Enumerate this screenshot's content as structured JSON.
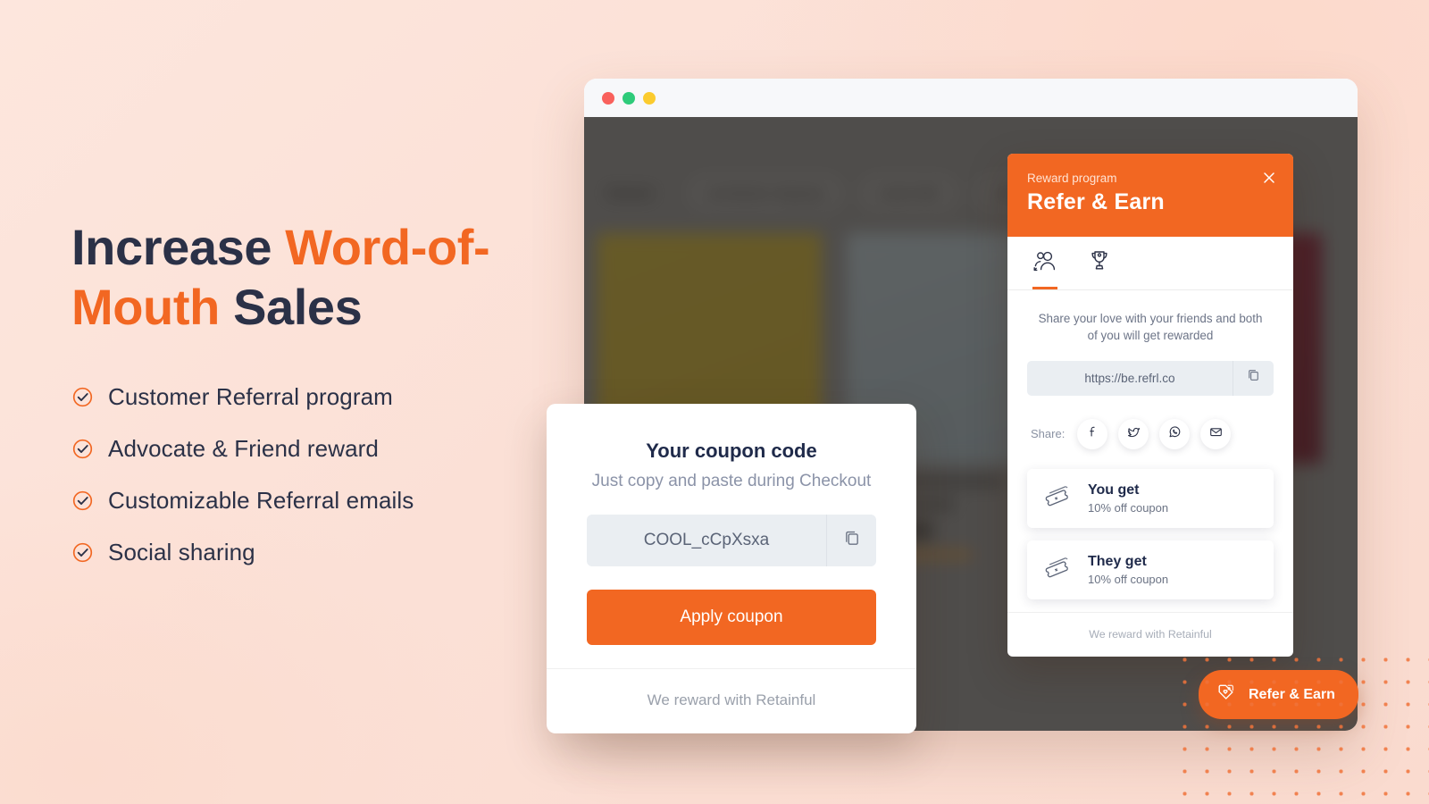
{
  "theme": {
    "accent": "#F26722",
    "heading_color": "#2B3147",
    "page_background": "#FBE0D6"
  },
  "marketing": {
    "headline_parts": [
      {
        "text": "Increase ",
        "accent": false
      },
      {
        "text": "Word-of-Mouth ",
        "accent": true
      },
      {
        "text": "Sales",
        "accent": false
      }
    ],
    "features": [
      {
        "icon": "check-circle-icon",
        "label": "Customer Referral program"
      },
      {
        "icon": "check-circle-icon",
        "label": "Advocate & Friend reward"
      },
      {
        "icon": "check-circle-icon",
        "label": "Customizable Referral emails"
      },
      {
        "icon": "check-circle-icon",
        "label": "Social sharing"
      }
    ]
  },
  "browser": {
    "traffic_lights": [
      "red",
      "green",
      "yellow"
    ],
    "storefront": {
      "chips": [
        "Related",
        "worldwide shipping",
        "under $50",
        "other"
      ]
    }
  },
  "widget": {
    "eyebrow": "Reward program",
    "title": "Refer & Earn",
    "close_icon": "close-icon",
    "tabs": [
      {
        "icon": "referral-people-icon",
        "active": true
      },
      {
        "icon": "trophy-icon",
        "active": false
      }
    ],
    "subtitle": "Share your love with your friends and both of you will get rewarded",
    "referral_link": "https://be.refrl.co",
    "copy_icon": "copy-icon",
    "share_label": "Share:",
    "share_buttons": [
      {
        "icon": "facebook-icon",
        "name": "Facebook"
      },
      {
        "icon": "twitter-icon",
        "name": "Twitter"
      },
      {
        "icon": "whatsapp-icon",
        "name": "WhatsApp"
      },
      {
        "icon": "email-icon",
        "name": "Email"
      }
    ],
    "rewards": [
      {
        "icon": "ticket-icon",
        "title": "You get",
        "desc": "10% off coupon"
      },
      {
        "icon": "ticket-icon",
        "title": "They get",
        "desc": "10% off coupon"
      }
    ],
    "footer": "We reward with Retainful"
  },
  "coupon": {
    "title": "Your coupon code",
    "subtitle": "Just copy and paste during Checkout",
    "code": "COOL_cCpXsxa",
    "copy_icon": "copy-icon",
    "apply_label": "Apply coupon",
    "footer": "We reward with Retainful"
  },
  "fab": {
    "icon": "tag-heart-icon",
    "label": "Refer & Earn"
  }
}
